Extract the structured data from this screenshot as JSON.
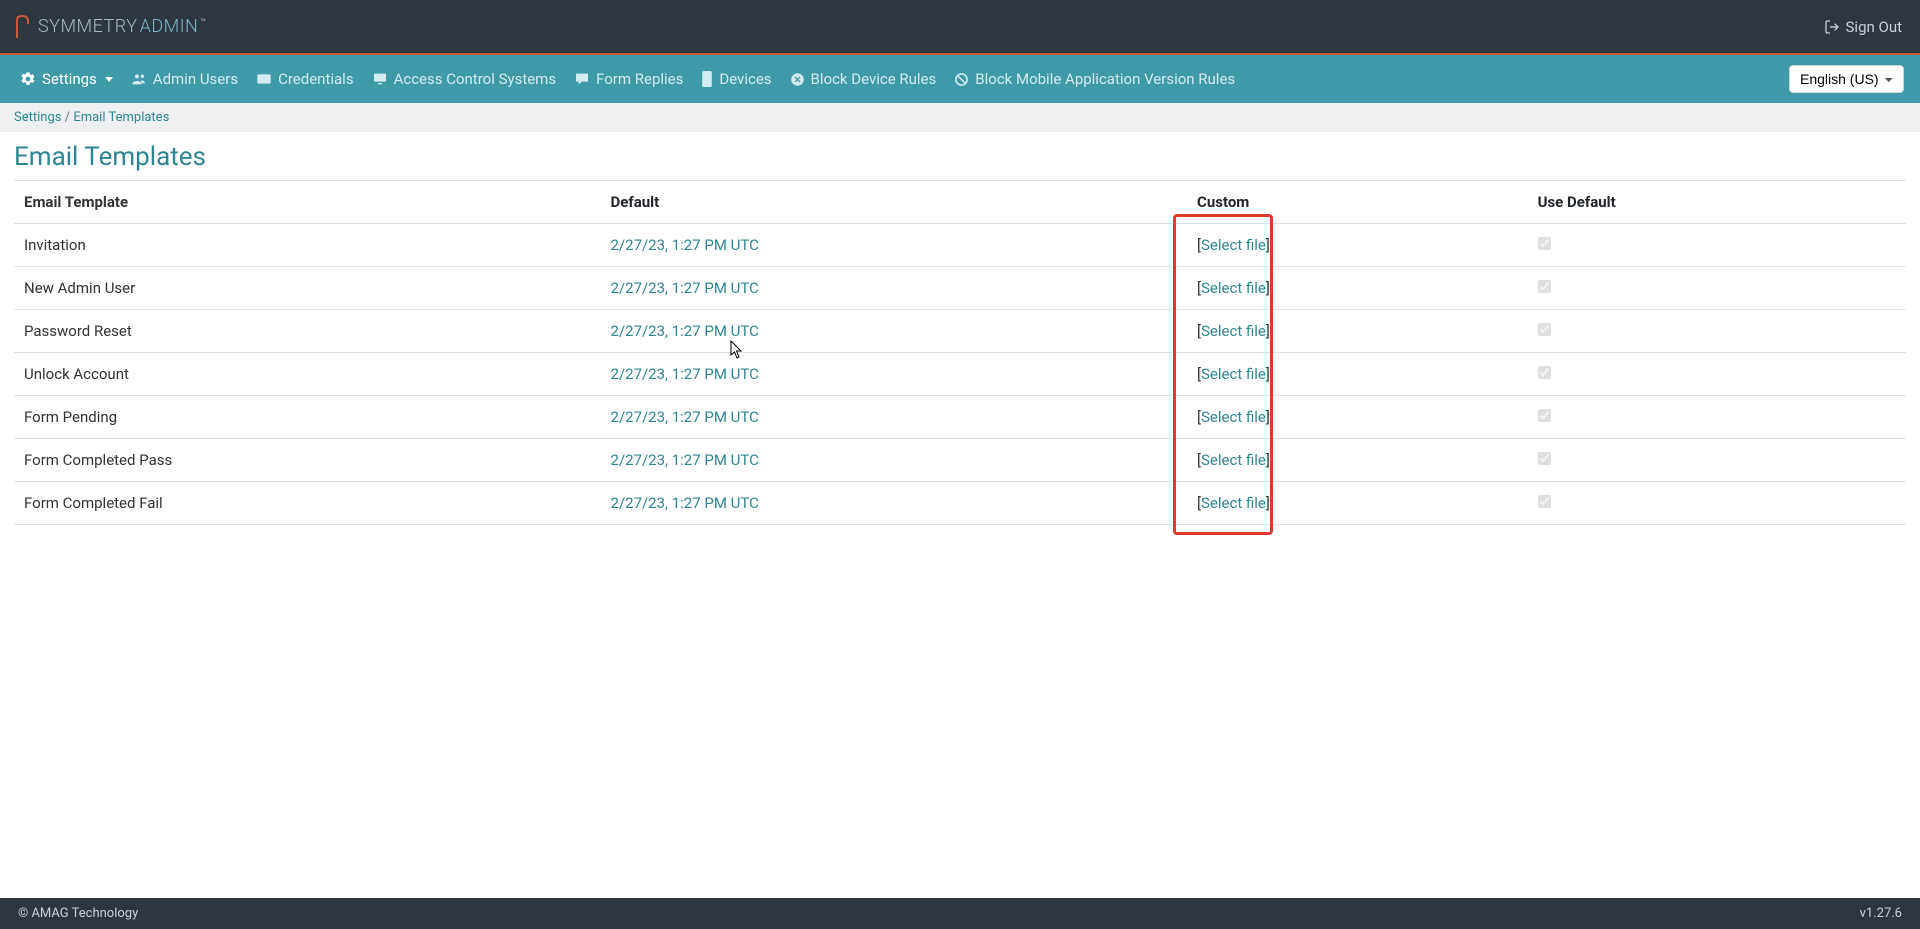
{
  "brand": {
    "part1": "SYMMETRY",
    "part2": "ADMIN"
  },
  "signout": "Sign Out",
  "nav": {
    "settings": "Settings",
    "admin_users": "Admin Users",
    "credentials": "Credentials",
    "access_control": "Access Control Systems",
    "form_replies": "Form Replies",
    "devices": "Devices",
    "block_device": "Block Device Rules",
    "block_mobile": "Block Mobile Application Version Rules"
  },
  "language": "English (US)",
  "breadcrumb": {
    "root": "Settings",
    "sep": "/",
    "current": "Email Templates"
  },
  "page_title": "Email Templates",
  "columns": {
    "template": "Email Template",
    "default": "Default",
    "custom": "Custom",
    "use_default": "Use Default"
  },
  "select_file_label": "Select file",
  "rows": [
    {
      "name": "Invitation",
      "default": "2/27/23, 1:27 PM UTC"
    },
    {
      "name": "New Admin User",
      "default": "2/27/23, 1:27 PM UTC"
    },
    {
      "name": "Password Reset",
      "default": "2/27/23, 1:27 PM UTC"
    },
    {
      "name": "Unlock Account",
      "default": "2/27/23, 1:27 PM UTC"
    },
    {
      "name": "Form Pending",
      "default": "2/27/23, 1:27 PM UTC"
    },
    {
      "name": "Form Completed Pass",
      "default": "2/27/23, 1:27 PM UTC"
    },
    {
      "name": "Form Completed Fail",
      "default": "2/27/23, 1:27 PM UTC"
    }
  ],
  "footer": {
    "copyright": "© AMAG Technology",
    "version": "v1.27.6"
  }
}
